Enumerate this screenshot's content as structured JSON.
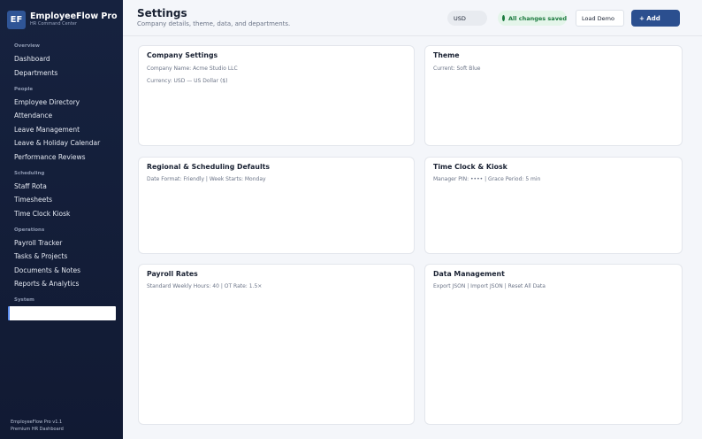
{
  "app": {
    "logo": "EF",
    "name": "EmployeeFlow Pro",
    "tagline": "HR Command Center"
  },
  "sidebar": {
    "sections": {
      "overview": "Overview",
      "people": "People",
      "scheduling": "Scheduling",
      "operations": "Operations",
      "system": "System"
    },
    "items": {
      "dashboard": "Dashboard",
      "departments": "Departments",
      "employee_directory": "Employee Directory",
      "attendance": "Attendance",
      "leave_management": "Leave Management",
      "leave_calendar": "Leave & Holiday Calendar",
      "performance_reviews": "Performance Reviews",
      "staff_rota": "Staff Rota",
      "timesheets": "Timesheets",
      "time_clock_kiosk": "Time Clock Kiosk",
      "payroll_tracker": "Payroll Tracker",
      "tasks_projects": "Tasks & Projects",
      "documents_notes": "Documents & Notes",
      "reports_analytics": "Reports & Analytics"
    },
    "system_input_value": "",
    "footer": {
      "version": "EmployeeFlow Pro v1.1",
      "edition": "Premium HR Dashboard"
    }
  },
  "header": {
    "title": "Settings",
    "subtitle": "Company details, theme, data, and departments.",
    "currency": "USD",
    "status": "All changes saved",
    "load_demo": "Load Demo",
    "add": "+ Add"
  },
  "cards": {
    "company": {
      "title": "Company Settings",
      "line1": "Company Name: Acme Studio LLC",
      "line2": "Currency: USD — US Dollar ($)"
    },
    "theme": {
      "title": "Theme",
      "line1": "Current: Soft Blue"
    },
    "regional": {
      "title": "Regional & Scheduling Defaults",
      "line1": "Date Format: Friendly   |   Week Starts: Monday"
    },
    "timeclock": {
      "title": "Time Clock & Kiosk",
      "line1": "Manager PIN: ••••   |   Grace Period: 5 min"
    },
    "payroll": {
      "title": "Payroll Rates",
      "line1": "Standard Weekly Hours: 40   |   OT Rate: 1.5×"
    },
    "data": {
      "title": "Data Management",
      "line1": "Export JSON   |   Import JSON   |   Reset All Data"
    }
  },
  "colors": {
    "sidebar_bg": "#16223f",
    "accent": "#2b4f8f",
    "status_green": "#1b7a3e",
    "page_bg": "#f4f6fa"
  }
}
